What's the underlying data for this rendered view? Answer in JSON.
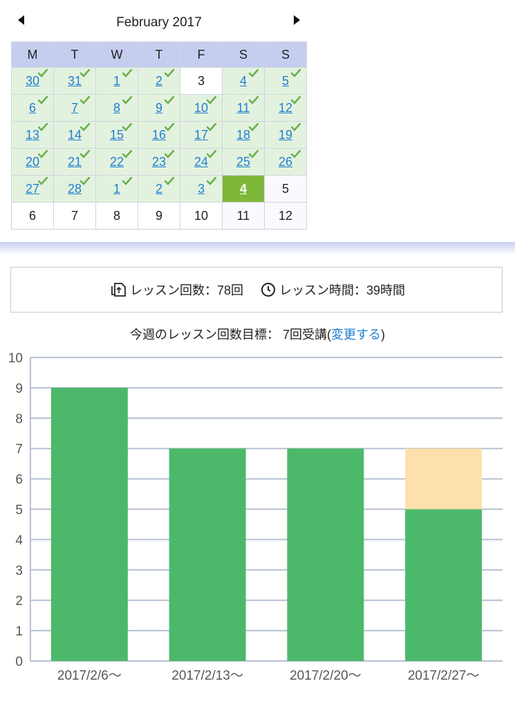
{
  "calendar": {
    "title": "February 2017",
    "prev_icon": "left-triangle-icon",
    "next_icon": "right-triangle-icon",
    "weekdays": [
      "M",
      "T",
      "W",
      "T",
      "F",
      "S",
      "S"
    ],
    "weeks": [
      [
        {
          "d": "30",
          "s": "done"
        },
        {
          "d": "31",
          "s": "done"
        },
        {
          "d": "1",
          "s": "done"
        },
        {
          "d": "2",
          "s": "done"
        },
        {
          "d": "3",
          "s": "plain"
        },
        {
          "d": "4",
          "s": "done"
        },
        {
          "d": "5",
          "s": "done"
        }
      ],
      [
        {
          "d": "6",
          "s": "done"
        },
        {
          "d": "7",
          "s": "done"
        },
        {
          "d": "8",
          "s": "done"
        },
        {
          "d": "9",
          "s": "done"
        },
        {
          "d": "10",
          "s": "done"
        },
        {
          "d": "11",
          "s": "done"
        },
        {
          "d": "12",
          "s": "done"
        }
      ],
      [
        {
          "d": "13",
          "s": "done"
        },
        {
          "d": "14",
          "s": "done"
        },
        {
          "d": "15",
          "s": "done"
        },
        {
          "d": "16",
          "s": "done"
        },
        {
          "d": "17",
          "s": "done"
        },
        {
          "d": "18",
          "s": "done"
        },
        {
          "d": "19",
          "s": "done"
        }
      ],
      [
        {
          "d": "20",
          "s": "done"
        },
        {
          "d": "21",
          "s": "done"
        },
        {
          "d": "22",
          "s": "done"
        },
        {
          "d": "23",
          "s": "done"
        },
        {
          "d": "24",
          "s": "done"
        },
        {
          "d": "25",
          "s": "done"
        },
        {
          "d": "26",
          "s": "done"
        }
      ],
      [
        {
          "d": "27",
          "s": "done"
        },
        {
          "d": "28",
          "s": "done"
        },
        {
          "d": "1",
          "s": "done"
        },
        {
          "d": "2",
          "s": "done"
        },
        {
          "d": "3",
          "s": "done"
        },
        {
          "d": "4",
          "s": "today"
        },
        {
          "d": "5",
          "s": "weekend"
        }
      ],
      [
        {
          "d": "6",
          "s": "plain"
        },
        {
          "d": "7",
          "s": "plain"
        },
        {
          "d": "8",
          "s": "plain"
        },
        {
          "d": "9",
          "s": "plain"
        },
        {
          "d": "10",
          "s": "plain"
        },
        {
          "d": "11",
          "s": "weekend"
        },
        {
          "d": "12",
          "s": "weekend"
        }
      ]
    ],
    "colors": {
      "done": "#e3f2df",
      "today": "#7eb83a",
      "check": "#6ab04c",
      "link": "#1e7fd0",
      "header": "#c6cef0"
    }
  },
  "stats": {
    "count_icon": "lesson-pages-icon",
    "count_text": "レッスン回数：78回",
    "time_icon": "clock-icon",
    "time_text": "レッスン時間：39時間"
  },
  "goal": {
    "prefix": "今週のレッスン回数目標： 7回受講(",
    "link": "変更する",
    "suffix": ")"
  },
  "chart_data": {
    "type": "bar",
    "stacked": true,
    "categories": [
      "2017/2/6〜",
      "2017/2/13〜",
      "2017/2/20〜",
      "2017/2/27〜"
    ],
    "series": [
      {
        "values": [
          9,
          7,
          7,
          5
        ],
        "color": "#4cb96a"
      },
      {
        "values": [
          0,
          0,
          0,
          2
        ],
        "color": "#fde0ab"
      }
    ],
    "yticks": [
      "0",
      "1",
      "2",
      "3",
      "4",
      "5",
      "6",
      "7",
      "8",
      "9",
      "10"
    ],
    "ylim": [
      0,
      10
    ],
    "grid": true
  }
}
